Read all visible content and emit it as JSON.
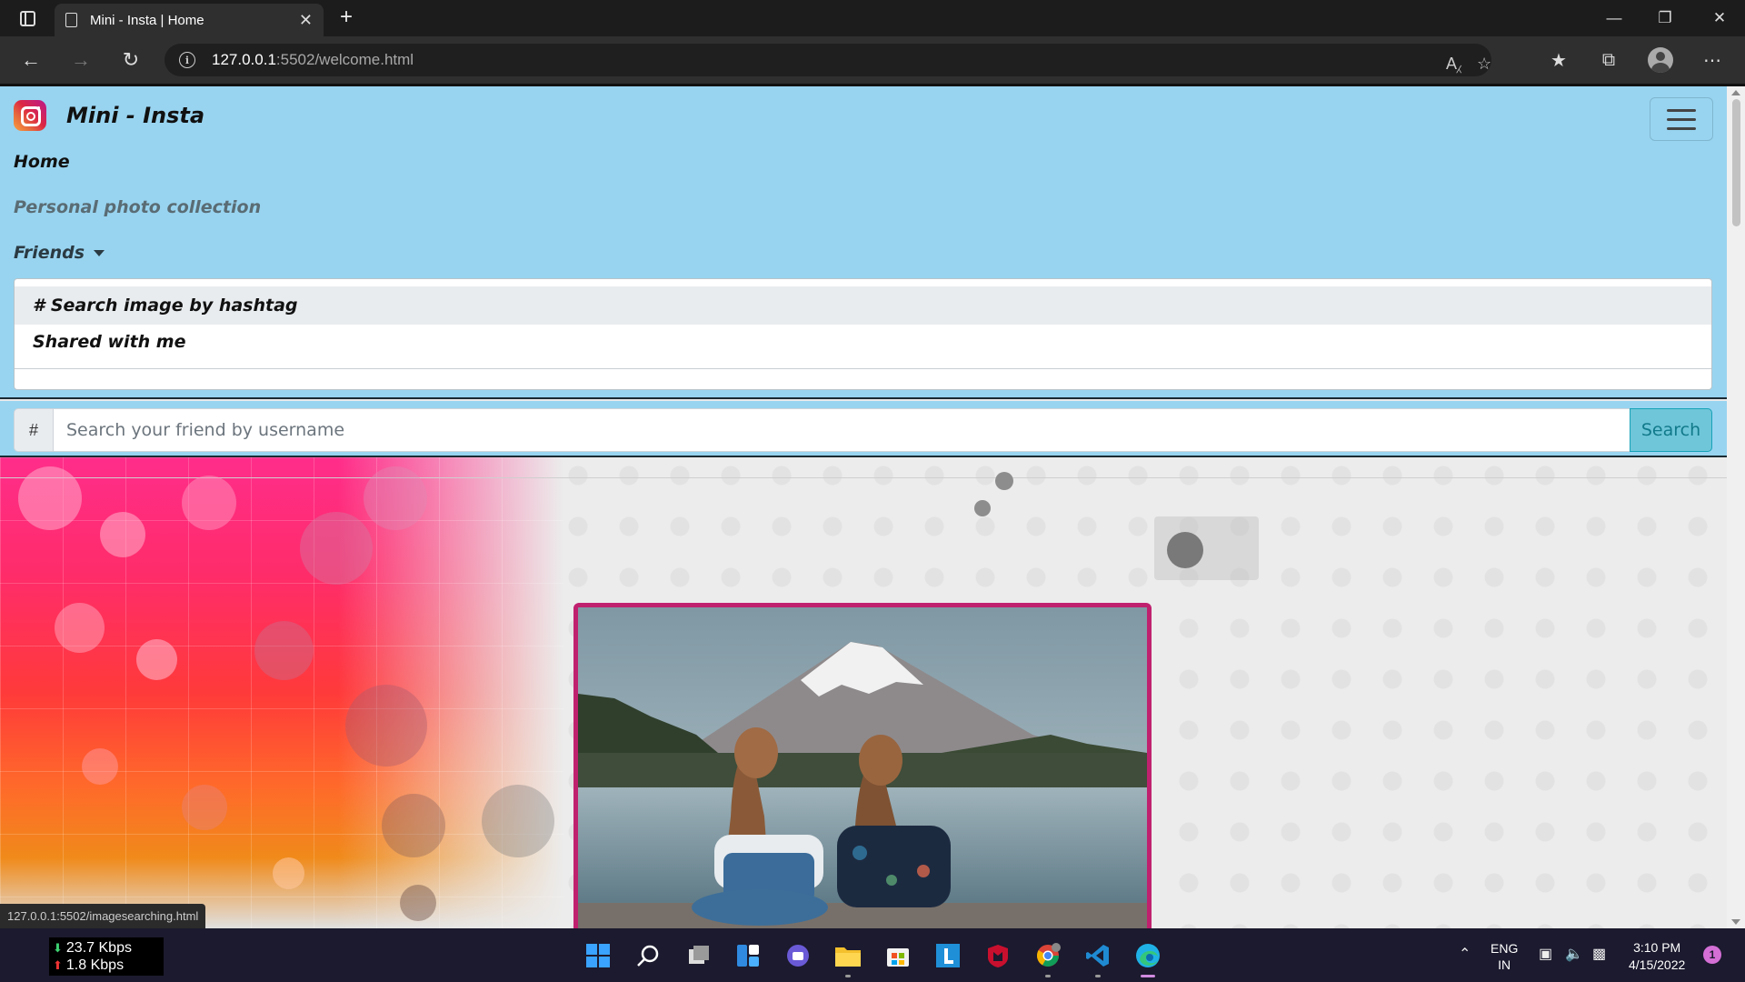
{
  "browser": {
    "tab_title": "Mini - Insta | Home",
    "tab_close": "✕",
    "new_tab": "+",
    "url_host": "127.0.0.1",
    "url_path": ":5502/welcome.html",
    "status_url": "127.0.0.1:5502/imagesearching.html"
  },
  "navbar": {
    "brand": "Mini - Insta",
    "links": [
      "Home",
      "Personal photo collection",
      "Friends"
    ],
    "dropdown": [
      "# Search image by hashtag",
      "Shared with me"
    ]
  },
  "search": {
    "addon": "#",
    "placeholder": "Search your friend by username",
    "button": "Search"
  },
  "colors": {
    "navbar_bg": "#98d4f0",
    "frame_border": "#c0216f",
    "search_btn": "#6fc6d8"
  },
  "taskbar": {
    "download_speed": "23.7 Kbps",
    "upload_speed": "1.8 Kbps",
    "lang_top": "ENG",
    "lang_bottom": "IN",
    "time": "3:10 PM",
    "date": "4/15/2022",
    "notifications": "1"
  }
}
